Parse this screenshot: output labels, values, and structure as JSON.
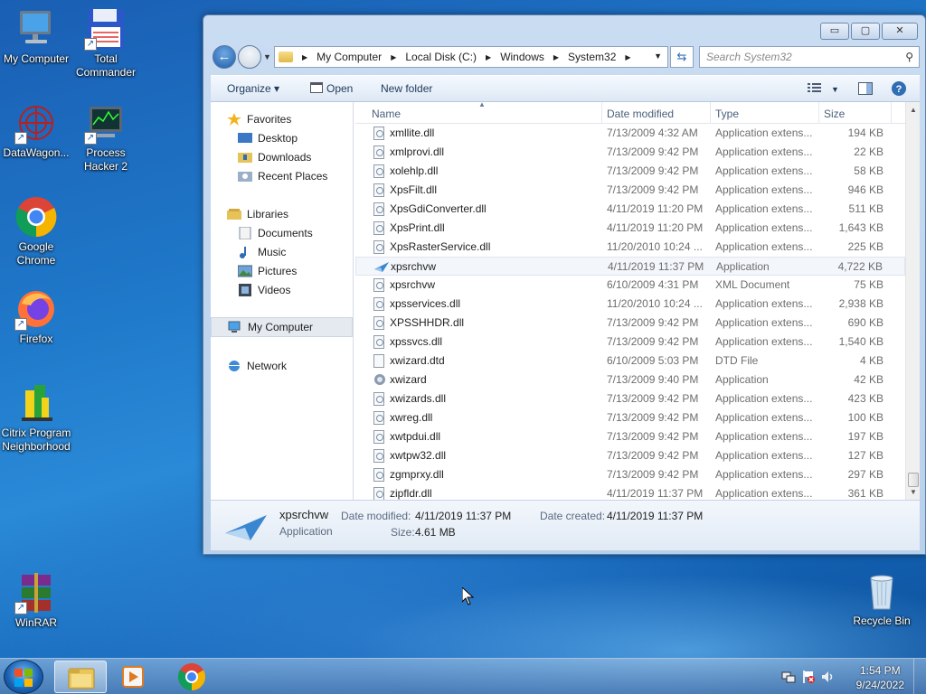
{
  "desktop": {
    "icons": [
      {
        "label": "My Computer"
      },
      {
        "label": "Total Commander"
      },
      {
        "label": "DataWagon..."
      },
      {
        "label": "Process Hacker 2"
      },
      {
        "label": "Google Chrome"
      },
      {
        "label": "Firefox"
      },
      {
        "label": "Citrix Program Neighborhood"
      },
      {
        "label": "WinRAR"
      },
      {
        "label": "Recycle Bin"
      }
    ]
  },
  "window": {
    "buttons": {
      "minimize": "▭",
      "maximize": "▢",
      "close": "✕"
    },
    "address": {
      "segments": [
        "My Computer",
        "Local Disk (C:)",
        "Windows",
        "System32"
      ],
      "search_placeholder": "Search System32"
    },
    "toolbar": {
      "organize": "Organize ▾",
      "open": "Open",
      "new_folder": "New folder"
    },
    "nav": {
      "favorites": "Favorites",
      "desktop": "Desktop",
      "downloads": "Downloads",
      "recent": "Recent Places",
      "libraries": "Libraries",
      "documents": "Documents",
      "music": "Music",
      "pictures": "Pictures",
      "videos": "Videos",
      "computer": "My Computer",
      "network": "Network"
    },
    "columns": {
      "name": "Name",
      "date": "Date modified",
      "type": "Type",
      "size": "Size"
    },
    "files": [
      {
        "name": "xmllite.dll",
        "date": "7/13/2009 4:32 AM",
        "type": "Application extens...",
        "size": "194 KB",
        "icon": "dll"
      },
      {
        "name": "xmlprovi.dll",
        "date": "7/13/2009 9:42 PM",
        "type": "Application extens...",
        "size": "22 KB",
        "icon": "dll"
      },
      {
        "name": "xolehlp.dll",
        "date": "7/13/2009 9:42 PM",
        "type": "Application extens...",
        "size": "58 KB",
        "icon": "dll"
      },
      {
        "name": "XpsFilt.dll",
        "date": "7/13/2009 9:42 PM",
        "type": "Application extens...",
        "size": "946 KB",
        "icon": "dll"
      },
      {
        "name": "XpsGdiConverter.dll",
        "date": "4/11/2019 11:20 PM",
        "type": "Application extens...",
        "size": "511 KB",
        "icon": "dll"
      },
      {
        "name": "XpsPrint.dll",
        "date": "4/11/2019 11:20 PM",
        "type": "Application extens...",
        "size": "1,643 KB",
        "icon": "dll"
      },
      {
        "name": "XpsRasterService.dll",
        "date": "11/20/2010 10:24 ...",
        "type": "Application extens...",
        "size": "225 KB",
        "icon": "dll"
      },
      {
        "name": "xpsrchvw",
        "date": "4/11/2019 11:37 PM",
        "type": "Application",
        "size": "4,722 KB",
        "icon": "app"
      },
      {
        "name": "xpsrchvw",
        "date": "6/10/2009 4:31 PM",
        "type": "XML Document",
        "size": "75 KB",
        "icon": "dll"
      },
      {
        "name": "xpsservices.dll",
        "date": "11/20/2010 10:24 ...",
        "type": "Application extens...",
        "size": "2,938 KB",
        "icon": "dll"
      },
      {
        "name": "XPSSHHDR.dll",
        "date": "7/13/2009 9:42 PM",
        "type": "Application extens...",
        "size": "690 KB",
        "icon": "dll"
      },
      {
        "name": "xpssvcs.dll",
        "date": "7/13/2009 9:42 PM",
        "type": "Application extens...",
        "size": "1,540 KB",
        "icon": "dll"
      },
      {
        "name": "xwizard.dtd",
        "date": "6/10/2009 5:03 PM",
        "type": "DTD File",
        "size": "4 KB",
        "icon": "plain"
      },
      {
        "name": "xwizard",
        "date": "7/13/2009 9:40 PM",
        "type": "Application",
        "size": "42 KB",
        "icon": "exe"
      },
      {
        "name": "xwizards.dll",
        "date": "7/13/2009 9:42 PM",
        "type": "Application extens...",
        "size": "423 KB",
        "icon": "dll"
      },
      {
        "name": "xwreg.dll",
        "date": "7/13/2009 9:42 PM",
        "type": "Application extens...",
        "size": "100 KB",
        "icon": "dll"
      },
      {
        "name": "xwtpdui.dll",
        "date": "7/13/2009 9:42 PM",
        "type": "Application extens...",
        "size": "197 KB",
        "icon": "dll"
      },
      {
        "name": "xwtpw32.dll",
        "date": "7/13/2009 9:42 PM",
        "type": "Application extens...",
        "size": "127 KB",
        "icon": "dll"
      },
      {
        "name": "zgmprxy.dll",
        "date": "7/13/2009 9:42 PM",
        "type": "Application extens...",
        "size": "297 KB",
        "icon": "dll"
      },
      {
        "name": "zipfldr.dll",
        "date": "4/11/2019 11:37 PM",
        "type": "Application extens...",
        "size": "361 KB",
        "icon": "dll"
      }
    ],
    "details": {
      "name": "xpsrchvw",
      "kind": "Application",
      "date_modified_label": "Date modified:",
      "date_modified": "4/11/2019 11:37 PM",
      "date_created_label": "Date created:",
      "date_created": "4/11/2019 11:37 PM",
      "size_label": "Size:",
      "size": "4.61 MB"
    }
  },
  "taskbar": {
    "time": "1:54 PM",
    "date": "9/24/2022"
  },
  "colors": {
    "accent": "#1a5fb4",
    "selection": "#e5eaf1"
  }
}
